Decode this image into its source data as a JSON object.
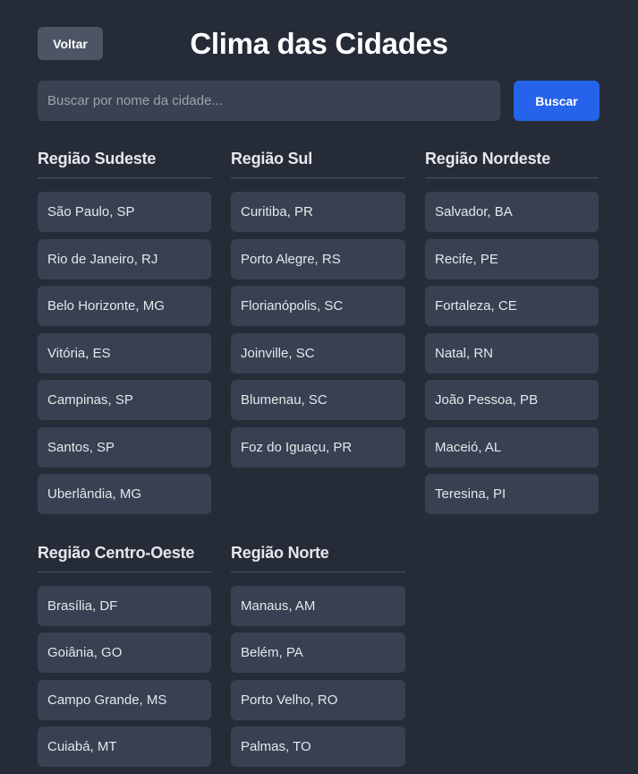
{
  "header": {
    "back_label": "Voltar",
    "title": "Clima das Cidades"
  },
  "search": {
    "placeholder": "Buscar por nome da cidade...",
    "value": "",
    "button_label": "Buscar"
  },
  "regions": [
    {
      "name": "Região Sudeste",
      "cities": [
        "São Paulo, SP",
        "Rio de Janeiro, RJ",
        "Belo Horizonte, MG",
        "Vitória, ES",
        "Campinas, SP",
        "Santos, SP",
        "Uberlândia, MG"
      ]
    },
    {
      "name": "Região Sul",
      "cities": [
        "Curitiba, PR",
        "Porto Alegre, RS",
        "Florianópolis, SC",
        "Joinville, SC",
        "Blumenau, SC",
        "Foz do Iguaçu, PR"
      ]
    },
    {
      "name": "Região Nordeste",
      "cities": [
        "Salvador, BA",
        "Recife, PE",
        "Fortaleza, CE",
        "Natal, RN",
        "João Pessoa, PB",
        "Maceió, AL",
        "Teresina, PI"
      ]
    },
    {
      "name": "Região Centro-Oeste",
      "cities": [
        "Brasília, DF",
        "Goiânia, GO",
        "Campo Grande, MS",
        "Cuiabá, MT"
      ]
    },
    {
      "name": "Região Norte",
      "cities": [
        "Manaus, AM",
        "Belém, PA",
        "Porto Velho, RO",
        "Palmas, TO"
      ]
    }
  ],
  "colors": {
    "background": "#262b38",
    "card": "#374151",
    "accent": "#2563eb",
    "back_button": "#4b5563"
  }
}
